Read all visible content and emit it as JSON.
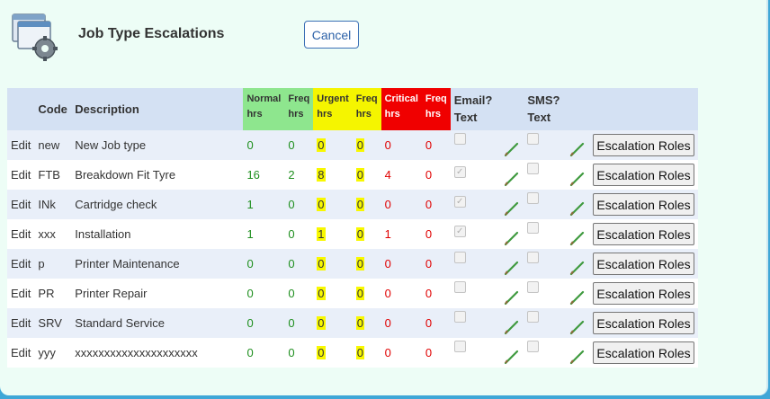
{
  "header": {
    "title": "Job Type Escalations",
    "cancel_label": "Cancel",
    "icon": "window-gear-icon"
  },
  "table": {
    "columns": {
      "edit": "",
      "code": "Code",
      "description": "Description",
      "normal_hrs": [
        "Normal",
        "hrs"
      ],
      "normal_freq": [
        "Freq",
        "hrs"
      ],
      "urgent_hrs": [
        "Urgent",
        "hrs"
      ],
      "urgent_freq": [
        "Freq",
        "hrs"
      ],
      "critical_hrs": [
        "Critical",
        "hrs"
      ],
      "critical_freq": [
        "Freq",
        "hrs"
      ],
      "email": [
        "Email?",
        "Text"
      ],
      "sms": [
        "SMS?",
        "Text"
      ]
    },
    "rows": [
      {
        "edit": "Edit",
        "code": "new",
        "description": "New Job type",
        "normal": "0",
        "nfreq": "0",
        "urgent": "0",
        "ufreq": "0",
        "critical": "0",
        "cfreq": "0",
        "email_checked": false,
        "sms_checked": false,
        "roles": "Escalation Roles"
      },
      {
        "edit": "Edit",
        "code": "FTB",
        "description": "Breakdown Fit Tyre",
        "normal": "16",
        "nfreq": "2",
        "urgent": "8",
        "ufreq": "0",
        "critical": "4",
        "cfreq": "0",
        "email_checked": true,
        "sms_checked": false,
        "roles": "Escalation Roles"
      },
      {
        "edit": "Edit",
        "code": "INk",
        "description": "Cartridge check",
        "normal": "1",
        "nfreq": "0",
        "urgent": "0",
        "ufreq": "0",
        "critical": "0",
        "cfreq": "0",
        "email_checked": true,
        "sms_checked": false,
        "roles": "Escalation Roles"
      },
      {
        "edit": "Edit",
        "code": "xxx",
        "description": "Installation",
        "normal": "1",
        "nfreq": "0",
        "urgent": "1",
        "ufreq": "0",
        "critical": "1",
        "cfreq": "0",
        "email_checked": true,
        "sms_checked": false,
        "roles": "Escalation Roles"
      },
      {
        "edit": "Edit",
        "code": "p",
        "description": "Printer Maintenance",
        "normal": "0",
        "nfreq": "0",
        "urgent": "0",
        "ufreq": "0",
        "critical": "0",
        "cfreq": "0",
        "email_checked": false,
        "sms_checked": false,
        "roles": "Escalation Roles"
      },
      {
        "edit": "Edit",
        "code": "PR",
        "description": "Printer Repair",
        "normal": "0",
        "nfreq": "0",
        "urgent": "0",
        "ufreq": "0",
        "critical": "0",
        "cfreq": "0",
        "email_checked": false,
        "sms_checked": false,
        "roles": "Escalation Roles"
      },
      {
        "edit": "Edit",
        "code": "SRV",
        "description": "Standard Service",
        "normal": "0",
        "nfreq": "0",
        "urgent": "0",
        "ufreq": "0",
        "critical": "0",
        "cfreq": "0",
        "email_checked": false,
        "sms_checked": false,
        "roles": "Escalation Roles"
      },
      {
        "edit": "Edit",
        "code": "yyy",
        "description": "xxxxxxxxxxxxxxxxxxxxx",
        "normal": "0",
        "nfreq": "0",
        "urgent": "0",
        "ufreq": "0",
        "critical": "0",
        "cfreq": "0",
        "email_checked": false,
        "sms_checked": false,
        "roles": "Escalation Roles"
      }
    ]
  },
  "colors": {
    "normal_header": "#8ee68e",
    "urgent_header": "#f5f500",
    "critical_header": "#f00000",
    "row_alt": "#e9eff9",
    "header_bg": "#d4e1f3"
  }
}
